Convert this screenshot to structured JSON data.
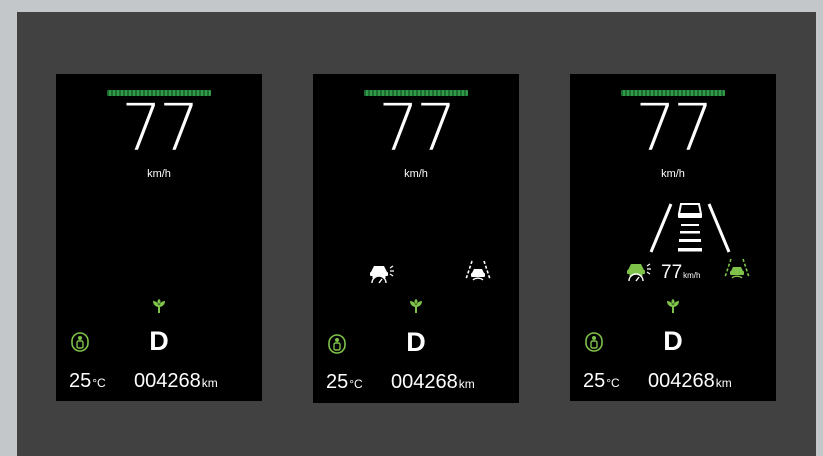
{
  "panels": [
    {
      "speed": "77",
      "speed_unit": "km/h",
      "gear": "D",
      "temperature": "25",
      "temperature_unit": "°C",
      "odometer": "004268",
      "odometer_unit": "km",
      "icons": [
        "speed-bar",
        "eco-leaf-icon",
        "seatbelt-icon"
      ]
    },
    {
      "speed": "77",
      "speed_unit": "km/h",
      "gear": "D",
      "temperature": "25",
      "temperature_unit": "°C",
      "odometer": "004268",
      "odometer_unit": "km",
      "icons": [
        "speed-bar",
        "adaptive-cruise-icon",
        "lane-keep-icon",
        "eco-leaf-icon",
        "seatbelt-icon"
      ]
    },
    {
      "speed": "77",
      "speed_unit": "km/h",
      "gear": "D",
      "temperature": "25",
      "temperature_unit": "°C",
      "odometer": "004268",
      "odometer_unit": "km",
      "acc_set_speed": "77",
      "acc_set_speed_unit": "km/h",
      "icons": [
        "speed-bar",
        "lane-road-graphic",
        "adaptive-cruise-icon",
        "lane-keep-icon",
        "eco-leaf-icon",
        "seatbelt-icon"
      ]
    }
  ],
  "colors": {
    "background": "#c4c7c9",
    "stage": "#414141",
    "panel": "#000000",
    "accent_green": "#7ec24a",
    "speedbar_green": "#2f9a48",
    "text": "#ffffff"
  }
}
